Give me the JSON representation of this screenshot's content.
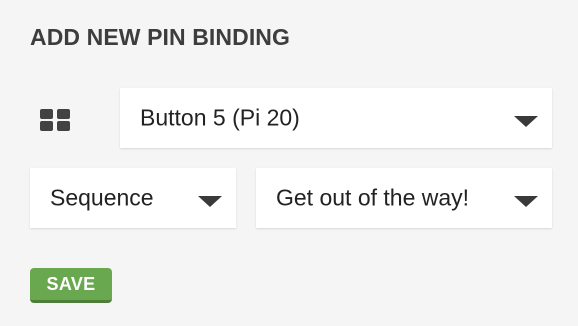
{
  "form": {
    "title": "ADD NEW PIN BINDING",
    "pin_icon": "grid-icon",
    "button_select": {
      "value": "Button 5 (Pi 20)",
      "icon": "chevron-down-icon"
    },
    "type_select": {
      "value": "Sequence",
      "icon": "chevron-down-icon"
    },
    "action_select": {
      "value": "Get out of the way!",
      "icon": "chevron-down-icon"
    },
    "save_label": "SAVE"
  },
  "colors": {
    "background": "#f5f5f5",
    "title_text": "#3d3d3d",
    "select_bg": "#ffffff",
    "save_button_bg": "#6aa84f",
    "save_button_text": "#ffffff"
  }
}
